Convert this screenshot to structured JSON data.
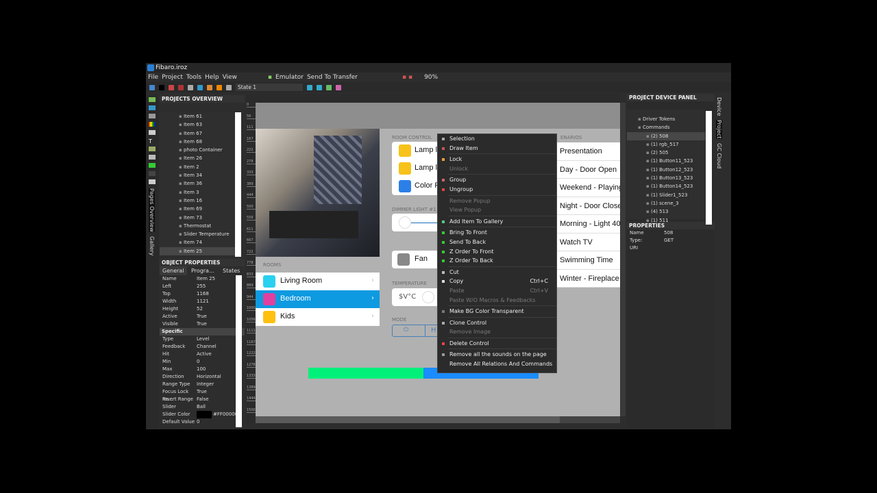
{
  "window": {
    "title": "Fibaro.iroz"
  },
  "menu": [
    "File",
    "Project",
    "Tools",
    "Help",
    "View"
  ],
  "menu_extra": {
    "emulator": "Emulator",
    "send": "Send To Transfer",
    "zoom": "90%"
  },
  "toolbar": {
    "state": "State 1"
  },
  "projects_overview": {
    "title": "PROJECTS OVERVIEW",
    "items": [
      "Item 61",
      "Item 63",
      "Item 67",
      "Item 68",
      "photo Container",
      "Item 26",
      "Item 2",
      "Item 34",
      "Item 36",
      "Item 3",
      "Item 16",
      "Item 69",
      "Item 73",
      "Thermostat",
      "Slider Temperature",
      "Item 74",
      "Item 25"
    ],
    "selected": "Item 25"
  },
  "left_vtabs": {
    "pages": "Pages Overview",
    "gallery": "Gallery"
  },
  "object_properties": {
    "title": "OBJECT PROPERTIES",
    "tabs": [
      "General",
      "Progra...",
      "States"
    ],
    "general": [
      [
        "Name",
        "Item 25"
      ],
      [
        "Left",
        "255"
      ],
      [
        "Top",
        "1168"
      ],
      [
        "Width",
        "1121"
      ],
      [
        "Height",
        "52"
      ],
      [
        "Active",
        "True"
      ],
      [
        "Visible",
        "True"
      ]
    ],
    "specific_label": "Specific",
    "specific": [
      [
        "Type",
        "Level"
      ],
      [
        "Feedback",
        "Channel"
      ],
      [
        "Hit",
        "Active"
      ],
      [
        "Min",
        "0"
      ],
      [
        "Max",
        "100"
      ],
      [
        "Direction",
        "Horizontal"
      ],
      [
        "Range Type",
        "Integer"
      ],
      [
        "Focus Lock Re...",
        "True"
      ],
      [
        "Invert Range",
        "False"
      ],
      [
        "Slider",
        "Ball"
      ],
      [
        "Slider Color",
        "#FF00000"
      ],
      [
        "Default Value",
        "0"
      ]
    ]
  },
  "ruler": [
    "0",
    "56",
    "111",
    "167",
    "222",
    "278",
    "333",
    "389",
    "444",
    "500",
    "556",
    "611",
    "667",
    "722",
    "778",
    "833",
    "889",
    "944",
    "1000",
    "1056",
    "1111",
    "1167",
    "1222",
    "1278",
    "1333",
    "1389",
    "1444",
    "1500"
  ],
  "canvas": {
    "rooms_label": "ROOMS",
    "rooms": [
      "Living Room",
      "Bedroom",
      "Kids"
    ],
    "room_control_label": "ROOM CONTROL",
    "room_controls": [
      "Lamp l",
      "Lamp l",
      "Color F"
    ],
    "dimmer_label": "DIMMER LIGHT #1",
    "fan": "Fan",
    "temperature_label": "TEMPERATURE",
    "temperature_value": "$V°C",
    "mode_label": "MODE",
    "mode_h": "H",
    "scenarios_label": "ENARIOS",
    "scenarios": [
      "Presentation",
      "Day - Door Open",
      "Weekend - Playing",
      "Night - Door Close",
      "Morning - Light 40",
      "Watch TV",
      "Swimming Time",
      "Winter - Fireplace"
    ],
    "slider_value_percent": 50,
    "colors": {
      "slider_fill": "#00f07a",
      "slider_track": "#1a8cff",
      "selected_room": "#0d9ae0"
    }
  },
  "context_menu": [
    {
      "label": "Selection",
      "enabled": true,
      "icon": "pointer"
    },
    {
      "label": "Draw Item",
      "enabled": true,
      "icon": "pen"
    },
    {
      "sep": true
    },
    {
      "label": "Lock",
      "enabled": true,
      "icon": "lock"
    },
    {
      "label": "Unlock",
      "enabled": false
    },
    {
      "sep": true
    },
    {
      "label": "Group",
      "enabled": true,
      "icon": "group"
    },
    {
      "label": "Ungroup",
      "enabled": true,
      "icon": "ungroup"
    },
    {
      "sep": true
    },
    {
      "label": "Remove Popup",
      "enabled": false
    },
    {
      "label": "View Popup",
      "enabled": false
    },
    {
      "sep": true
    },
    {
      "label": "Add Item To Gallery",
      "enabled": true,
      "icon": "gallery"
    },
    {
      "sep": true
    },
    {
      "label": "Bring To Front",
      "enabled": true,
      "icon": "front"
    },
    {
      "label": "Send To Back",
      "enabled": true,
      "icon": "back"
    },
    {
      "label": "Z Order To Front",
      "enabled": true,
      "icon": "zfront"
    },
    {
      "label": "Z Order To Back",
      "enabled": true,
      "icon": "zback"
    },
    {
      "sep": true
    },
    {
      "label": "Cut",
      "enabled": true,
      "icon": "cut"
    },
    {
      "label": "Copy",
      "enabled": true,
      "shortcut": "Ctrl+C",
      "icon": "copy"
    },
    {
      "label": "Paste",
      "enabled": false,
      "shortcut": "Ctrl+V"
    },
    {
      "label": "Paste W/O Macros & Feedbacks",
      "enabled": false
    },
    {
      "sep": true
    },
    {
      "label": "Make BG Color Transparent",
      "enabled": true,
      "icon": "transparent"
    },
    {
      "sep": true
    },
    {
      "label": "Clone Control",
      "enabled": true,
      "icon": "clone"
    },
    {
      "label": "Remove Image",
      "enabled": false
    },
    {
      "sep": true
    },
    {
      "label": "Delete Control",
      "enabled": true,
      "icon": "delete"
    },
    {
      "sep": true
    },
    {
      "label": "Remove all the sounds on the page",
      "enabled": true,
      "icon": "sound"
    },
    {
      "label": "Remove All Relations And Commands",
      "enabled": true
    }
  ],
  "device_panel": {
    "title": "PROJECT DEVICE PANEL",
    "items": [
      "Driver Tokens",
      "Commands",
      "(2) 508",
      "(1) rgb_517",
      "(2) 505",
      "(1) Button11_523",
      "(1) Button12_523",
      "(1) Button13_523",
      "(1) Button14_523",
      "(1) Slider1_523",
      "(1) scene_3",
      "(4) 513",
      "(1) 511"
    ],
    "selected": "(2) 508"
  },
  "properties": {
    "title": "PROPERTIES",
    "rows": [
      [
        "Name",
        "508"
      ],
      [
        "Type:",
        "GET"
      ],
      [
        "URI",
        ""
      ]
    ]
  },
  "right_vtabs": [
    "Device",
    "Project",
    "GC Cloud"
  ]
}
